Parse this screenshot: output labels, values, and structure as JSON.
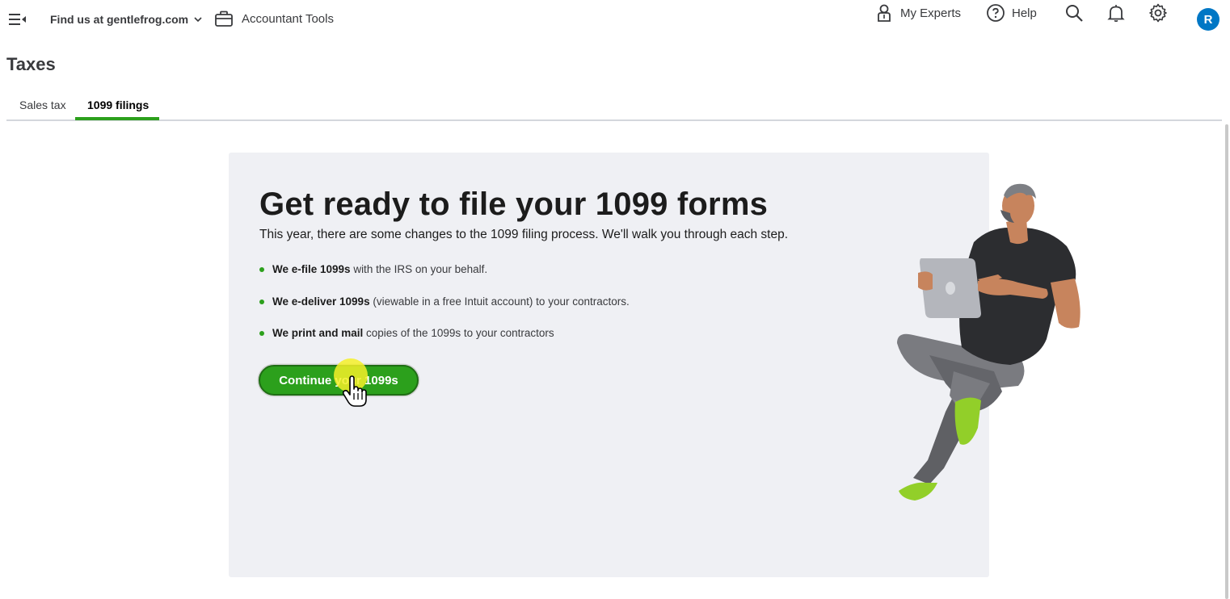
{
  "topbar": {
    "company_label": "Find us at gentlefrog.com",
    "accountant_tools_label": "Accountant Tools",
    "my_experts_label": "My Experts",
    "help_label": "Help",
    "avatar_initial": "R"
  },
  "page": {
    "title": "Taxes"
  },
  "tabs": [
    {
      "label": "Sales tax",
      "active": false
    },
    {
      "label": "1099 filings",
      "active": true
    }
  ],
  "card": {
    "headline": "Get ready to file your 1099 forms",
    "subline": "This year, there are some changes to the 1099 filing process. We'll walk you through each step.",
    "bullets": [
      {
        "bold": "We e-file 1099s",
        "rest": " with the IRS on your behalf."
      },
      {
        "bold": "We e-deliver 1099s",
        "rest": " (viewable in a free Intuit account) to your contractors."
      },
      {
        "bold": "We print and mail",
        "rest": " copies of the 1099s to your contractors"
      }
    ],
    "cta_label": "Continue your 1099s"
  },
  "colors": {
    "brand_green": "#2ca01c",
    "avatar_blue": "#0077c5",
    "card_bg": "#eff0f4"
  },
  "icons": [
    "menu-toggle-icon",
    "chevron-down-icon",
    "briefcase-icon",
    "person-icon",
    "help-icon",
    "search-icon",
    "bell-icon",
    "gear-icon"
  ]
}
